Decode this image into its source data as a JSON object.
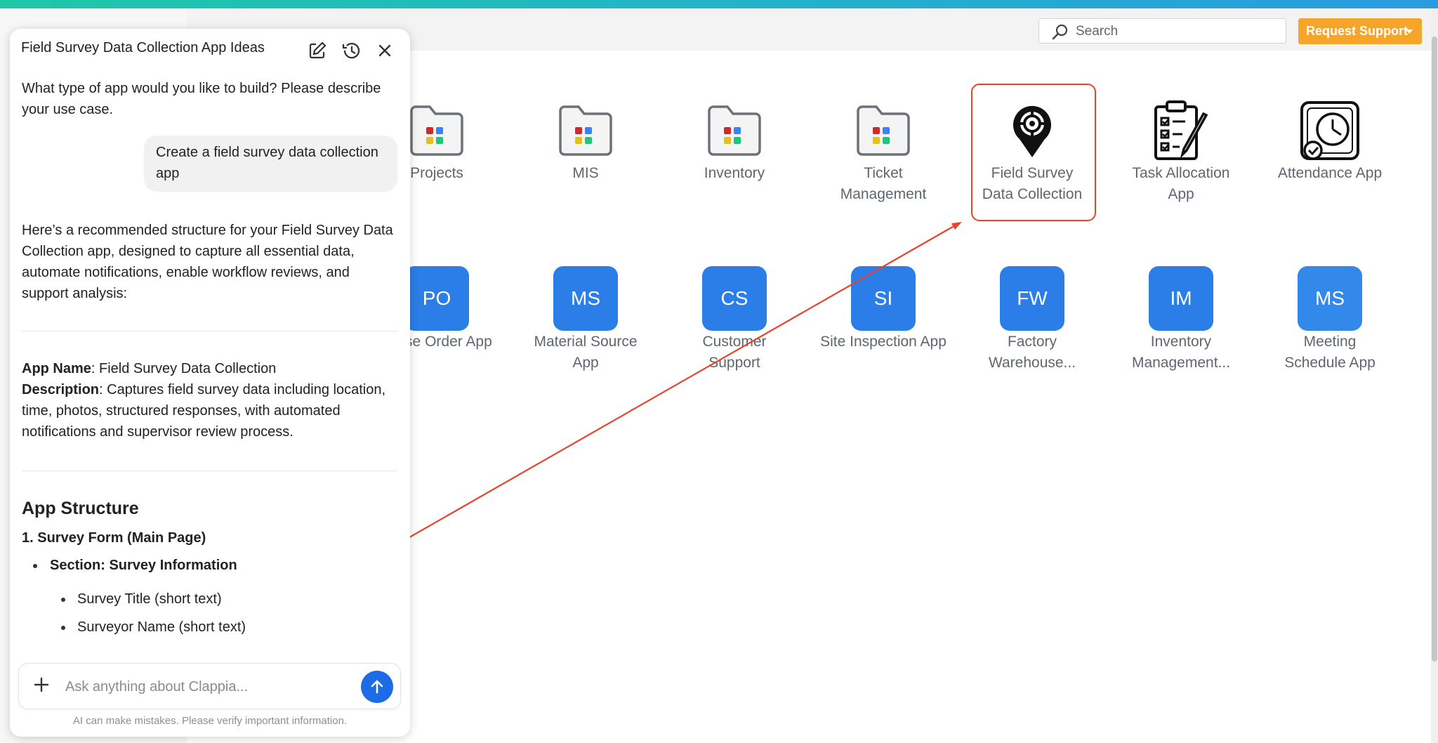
{
  "header": {
    "search_placeholder": "Search",
    "support_label": "Request Support",
    "accent_color": "#f7a52a"
  },
  "apps_row1": [
    {
      "label": "Projects",
      "icon": "folder-icon"
    },
    {
      "label": "MIS",
      "icon": "folder-icon"
    },
    {
      "label": "Inventory",
      "icon": "folder-icon"
    },
    {
      "label": "Ticket Management",
      "icon": "folder-icon"
    },
    {
      "label": "Field Survey Data Collection",
      "icon": "location-pin-icon",
      "selected": true
    },
    {
      "label": "Task Allocation App",
      "icon": "clipboard-checklist-icon"
    },
    {
      "label": "Attendance App",
      "icon": "clock-check-icon"
    }
  ],
  "apps_row2": [
    {
      "abbr": "PO",
      "label": "chase Order App"
    },
    {
      "abbr": "MS",
      "label": "Material Source App"
    },
    {
      "abbr": "CS",
      "label": "Customer Support"
    },
    {
      "abbr": "SI",
      "label": "Site Inspection App"
    },
    {
      "abbr": "FW",
      "label": "Factory Warehouse..."
    },
    {
      "abbr": "IM",
      "label": "Inventory Management..."
    },
    {
      "abbr": "MS",
      "label": "Meeting Schedule App"
    }
  ],
  "chat": {
    "title": "Field Survey Data Collection App Ideas",
    "assistant_intro": "What type of app would you like to build? Please describe your use case.",
    "user_message": "Create a field survey data collection app",
    "assistant_reply": "Here’s a recommended structure for your Field Survey Data Collection app, designed to capture all essential data, automate notifications, enable workflow reviews, and support analysis:",
    "app_name_label": "App Name",
    "app_name_value": ": Field Survey Data Collection",
    "description_label": "Description",
    "description_value": ": Captures field survey data including location, time, photos, structured responses, with automated notifications and supervisor review process.",
    "structure_heading": "App Structure",
    "section_1": "1. Survey Form (Main Page)",
    "subsection": "Section: Survey Information",
    "fields": [
      "Survey Title (short text)",
      "Surveyor Name (short text)"
    ],
    "input_placeholder": "Ask anything about Clappia...",
    "disclaimer": "AI can make mistakes. Please verify important information."
  }
}
